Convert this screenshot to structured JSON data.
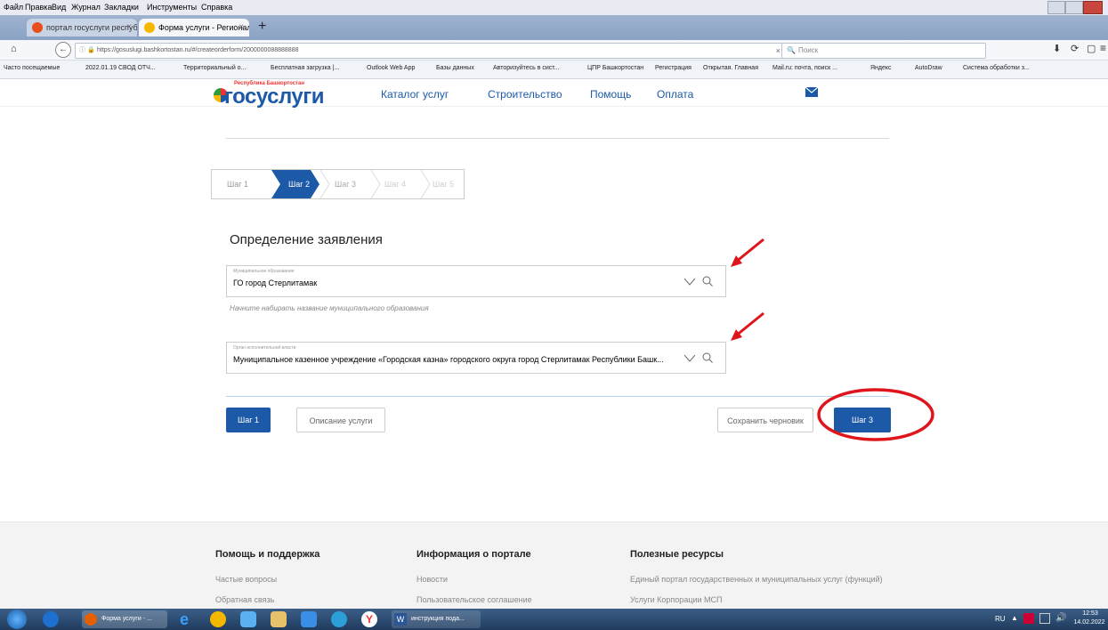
{
  "browser": {
    "menu": [
      "Файл",
      "Правка",
      "Вид",
      "Журнал",
      "Закладки",
      "Инструменты",
      "Справка"
    ],
    "tabs": [
      {
        "label": "портал госуслуги республ",
        "active": false
      },
      {
        "label": "Форма услуги - Региональ",
        "active": true
      }
    ],
    "url": "https://gosuslugi.bashkortostan.ru/#/createorderform/2000000088888888",
    "search_placeholder": "Поиск",
    "bookmarks": [
      "Часто посещаемые",
      "2022.01.19 СВОД ОТЧ...",
      "Территориальный о...",
      "Бесплатная загрузка |...",
      "Outlook Web App",
      "Базы данных",
      "Авторизуйтесь в сист...",
      "ЦПР Башкортостан",
      "Регистрация",
      "Открытая. Главная",
      "Mail.ru: почта, поиск ...",
      "Яндекс",
      "AutoDraw",
      "Система обработки з..."
    ]
  },
  "site": {
    "logo_top": "Республика Башкортостан",
    "logo": "госуслуги",
    "nav": [
      "Каталог услуг",
      "Строительство",
      "Помощь",
      "Оплата"
    ]
  },
  "steps": [
    "Шаг 1",
    "Шаг 2",
    "Шаг 3",
    "Шаг 4",
    "Шаг 5"
  ],
  "form": {
    "title": "Определение заявления",
    "municipality_label": "Муниципальное образование",
    "municipality_value": "ГО город Стерлитамак",
    "municipality_hint": "Начните набирать название муниципального образования",
    "authority_label": "Орган исполнительной власти",
    "authority_value": "Муниципальное казенное учреждение «Городская казна» городского округа город Стерлитамак Республики Башк..."
  },
  "buttons": {
    "back": "Шаг 1",
    "description": "Описание услуги",
    "save_draft": "Сохранить черновик",
    "next": "Шаг 3"
  },
  "footer": {
    "col1": {
      "title": "Помощь и поддержка",
      "links": [
        "Частые вопросы",
        "Обратная связь"
      ]
    },
    "col2": {
      "title": "Информация о портале",
      "links": [
        "Новости",
        "Пользовательское соглашение"
      ]
    },
    "col3": {
      "title": "Полезные ресурсы",
      "links": [
        "Единый портал государственных и муниципальных услуг (функций)",
        "Услуги Корпорации МСП"
      ]
    }
  },
  "taskbar": {
    "items": [
      "Форма услуги - ...",
      "инструкция пода..."
    ],
    "lang": "RU",
    "time": "12:53",
    "date": "14.02.2022"
  },
  "colors": {
    "accent": "#1c5aa8",
    "annotation": "#e0141b"
  }
}
